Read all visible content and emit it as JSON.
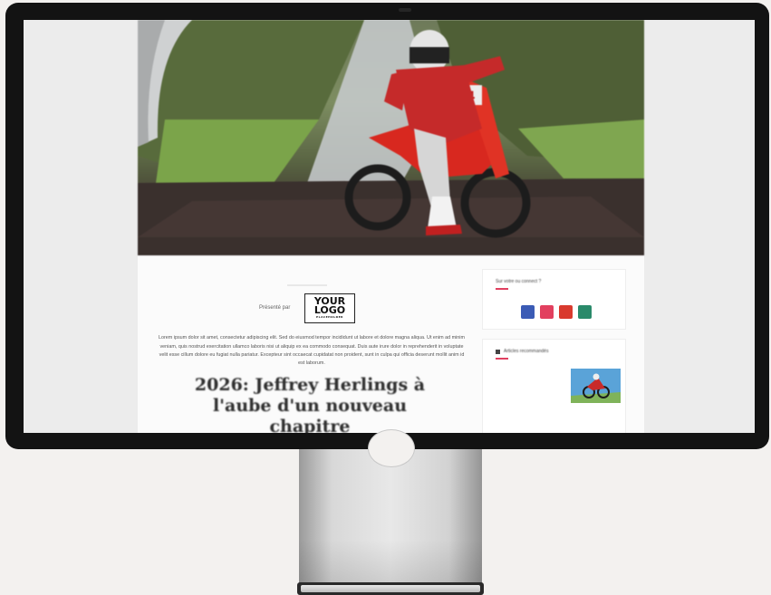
{
  "article": {
    "presented_by": "Présenté par",
    "logo_line1": "YOUR",
    "logo_line2": "LOGO",
    "logo_line3": "PLACEHOLDER",
    "lorem": "Lorem ipsum dolor sit amet, consectetur adipiscing elit. Sed do eiusmod tempor incididunt ut labore et dolore magna aliqua. Ut enim ad minim veniam, quis nostrud exercitation ullamco laboris nisi ut aliquip ex ea commodo consequat. Duis aute irure dolor in reprehenderit in voluptate velit esse cillum dolore eu fugiat nulla pariatur. Excepteur sint occaecat cupidatat non proident, sunt in culpa qui officia deserunt mollit anim id est laborum.",
    "headline": "2026: Jeffrey Herlings à l'aube d'un nouveau chapitre"
  },
  "sidebar": {
    "social_title": "Sur votre ou connect ?",
    "social_colors": [
      "#3b5bb5",
      "#e2405f",
      "#d93a2e",
      "#2a8a6a"
    ],
    "recommended_title": "Articles recommandés",
    "thumb_color": "#5aa3d8"
  },
  "colors": {
    "accent": "#e04060",
    "link": "#1f3a7a"
  }
}
